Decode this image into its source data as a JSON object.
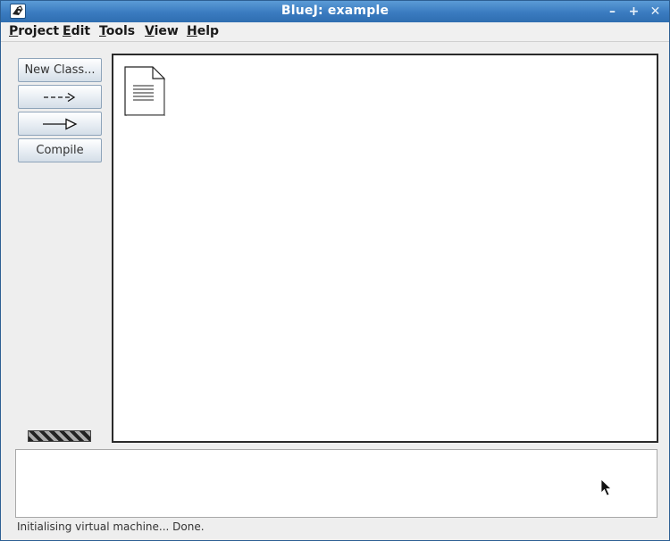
{
  "window": {
    "title": "BlueJ:  example"
  },
  "titlebar_buttons": {
    "minimize_glyph": "–",
    "maximize_glyph": "+",
    "close_glyph": "✕"
  },
  "menu": {
    "items": [
      "Project",
      "Edit",
      "Tools",
      "View",
      "Help"
    ]
  },
  "toolbar": {
    "new_class_label": "New Class...",
    "compile_label": "Compile"
  },
  "status": {
    "message": "Initialising virtual machine... Done."
  }
}
